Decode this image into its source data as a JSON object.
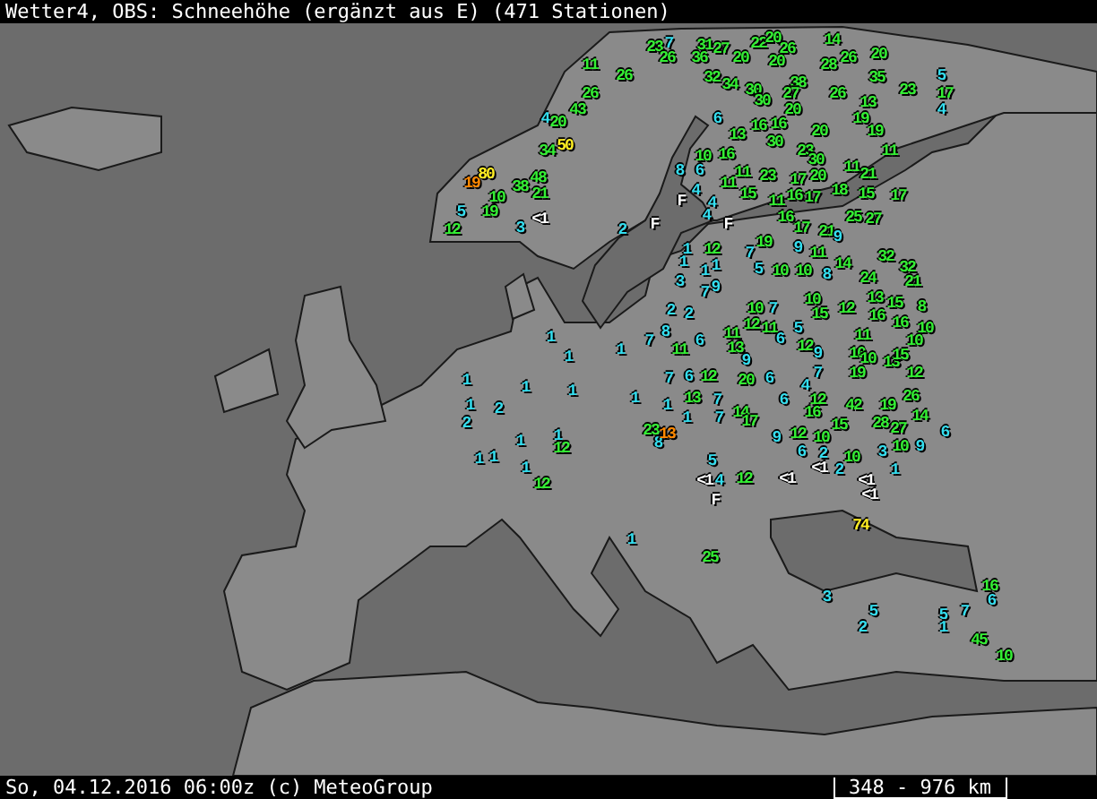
{
  "title_bar": {
    "title": "Wetter4, OBS: Schneehöhe (ergänzt aus E) (471 Stationen)"
  },
  "map": {
    "labels": [
      {
        "text": "23",
        "color": "#33ee33"
      },
      {
        "text": "7",
        "color": "#33ddee"
      },
      {
        "text": "31",
        "color": "#33ee33"
      },
      {
        "text": "27",
        "color": "#33ee33"
      },
      {
        "text": "22",
        "color": "#33ee33"
      },
      {
        "text": "20",
        "color": "#33ee33"
      },
      {
        "text": "26",
        "color": "#33ee33"
      },
      {
        "text": "14",
        "color": "#33ee33"
      },
      {
        "text": "11",
        "color": "#33ee33"
      },
      {
        "text": "26",
        "color": "#33ee33"
      },
      {
        "text": "36",
        "color": "#33ee33"
      },
      {
        "text": "20",
        "color": "#33ee33"
      },
      {
        "text": "20",
        "color": "#33ee33"
      },
      {
        "text": "28",
        "color": "#33ee33"
      },
      {
        "text": "26",
        "color": "#33ee33"
      },
      {
        "text": "20",
        "color": "#33ee33"
      },
      {
        "text": "26",
        "color": "#33ee33"
      },
      {
        "text": "32",
        "color": "#33ee33"
      },
      {
        "text": "34",
        "color": "#33ee33"
      },
      {
        "text": "38",
        "color": "#33ee33"
      },
      {
        "text": "35",
        "color": "#33ee33"
      },
      {
        "text": "5",
        "color": "#33ddee"
      },
      {
        "text": "26",
        "color": "#33ee33"
      },
      {
        "text": "30",
        "color": "#33ee33"
      },
      {
        "text": "27",
        "color": "#33ee33"
      },
      {
        "text": "26",
        "color": "#33ee33"
      },
      {
        "text": "23",
        "color": "#33ee33"
      },
      {
        "text": "17",
        "color": "#33ee33"
      },
      {
        "text": "43",
        "color": "#33ee33"
      },
      {
        "text": "30",
        "color": "#33ee33"
      },
      {
        "text": "20",
        "color": "#33ee33"
      },
      {
        "text": "13",
        "color": "#33ee33"
      },
      {
        "text": "4",
        "color": "#33ddee"
      },
      {
        "text": "4",
        "color": "#33ddee"
      },
      {
        "text": "20",
        "color": "#33ee33"
      },
      {
        "text": "6",
        "color": "#33ddee"
      },
      {
        "text": "16",
        "color": "#33ee33"
      },
      {
        "text": "16",
        "color": "#33ee33"
      },
      {
        "text": "19",
        "color": "#33ee33"
      },
      {
        "text": "13",
        "color": "#33ee33"
      },
      {
        "text": "20",
        "color": "#33ee33"
      },
      {
        "text": "19",
        "color": "#33ee33"
      },
      {
        "text": "34",
        "color": "#33ee33"
      },
      {
        "text": "50",
        "color": "#ffee22"
      },
      {
        "text": "30",
        "color": "#33ee33"
      },
      {
        "text": "23",
        "color": "#33ee33"
      },
      {
        "text": "11",
        "color": "#33ee33"
      },
      {
        "text": "10",
        "color": "#33ee33"
      },
      {
        "text": "16",
        "color": "#33ee33"
      },
      {
        "text": "30",
        "color": "#33ee33"
      },
      {
        "text": "19",
        "color": "#ff8800"
      },
      {
        "text": "80",
        "color": "#ffee22"
      },
      {
        "text": "38",
        "color": "#33ee33"
      },
      {
        "text": "48",
        "color": "#33ee33"
      },
      {
        "text": "8",
        "color": "#33ddee"
      },
      {
        "text": "6",
        "color": "#33ddee"
      },
      {
        "text": "11",
        "color": "#33ee33"
      },
      {
        "text": "11",
        "color": "#33ee33"
      },
      {
        "text": "23",
        "color": "#33ee33"
      },
      {
        "text": "17",
        "color": "#33ee33"
      },
      {
        "text": "20",
        "color": "#33ee33"
      },
      {
        "text": "11",
        "color": "#33ee33"
      },
      {
        "text": "21",
        "color": "#33ee33"
      },
      {
        "text": "10",
        "color": "#33ee33"
      },
      {
        "text": "21",
        "color": "#33ee33"
      },
      {
        "text": "F",
        "color": "#ffffff"
      },
      {
        "text": "4",
        "color": "#33ddee"
      },
      {
        "text": "4",
        "color": "#33ddee"
      },
      {
        "text": "15",
        "color": "#33ee33"
      },
      {
        "text": "11",
        "color": "#33ee33"
      },
      {
        "text": "16",
        "color": "#33ee33"
      },
      {
        "text": "17",
        "color": "#33ee33"
      },
      {
        "text": "18",
        "color": "#33ee33"
      },
      {
        "text": "15",
        "color": "#33ee33"
      },
      {
        "text": "17",
        "color": "#33ee33"
      },
      {
        "text": "12",
        "color": "#33ee33"
      },
      {
        "text": "5",
        "color": "#33ddee"
      },
      {
        "text": "19",
        "color": "#33ee33"
      },
      {
        "text": "3",
        "color": "#33ddee"
      },
      {
        "text": "<1",
        "color": "#ffffff"
      },
      {
        "text": "2",
        "color": "#33ddee"
      },
      {
        "text": "F",
        "color": "#ffffff"
      },
      {
        "text": "4",
        "color": "#33ddee"
      },
      {
        "text": "F",
        "color": "#ffffff"
      },
      {
        "text": "16",
        "color": "#33ee33"
      },
      {
        "text": "25",
        "color": "#33ee33"
      },
      {
        "text": "27",
        "color": "#33ee33"
      },
      {
        "text": "17",
        "color": "#33ee33"
      },
      {
        "text": "21",
        "color": "#33ee33"
      },
      {
        "text": "9",
        "color": "#33ddee"
      },
      {
        "text": "1",
        "color": "#33ddee"
      },
      {
        "text": "12",
        "color": "#33ee33"
      },
      {
        "text": "7",
        "color": "#33ddee"
      },
      {
        "text": "19",
        "color": "#33ee33"
      },
      {
        "text": "9",
        "color": "#33ddee"
      },
      {
        "text": "11",
        "color": "#33ee33"
      },
      {
        "text": "1",
        "color": "#33ddee"
      },
      {
        "text": "1",
        "color": "#33ddee"
      },
      {
        "text": "1",
        "color": "#33ddee"
      },
      {
        "text": "5",
        "color": "#33ddee"
      },
      {
        "text": "10",
        "color": "#33ee33"
      },
      {
        "text": "10",
        "color": "#33ee33"
      },
      {
        "text": "14",
        "color": "#33ee33"
      },
      {
        "text": "32",
        "color": "#33ee33"
      },
      {
        "text": "32",
        "color": "#33ee33"
      },
      {
        "text": "3",
        "color": "#33ddee"
      },
      {
        "text": "8",
        "color": "#33ddee"
      },
      {
        "text": "24",
        "color": "#33ee33"
      },
      {
        "text": "21",
        "color": "#33ee33"
      },
      {
        "text": "7",
        "color": "#33ddee"
      },
      {
        "text": "9",
        "color": "#33ddee"
      },
      {
        "text": "2",
        "color": "#33ddee"
      },
      {
        "text": "2",
        "color": "#33ddee"
      },
      {
        "text": "10",
        "color": "#33ee33"
      },
      {
        "text": "7",
        "color": "#33ddee"
      },
      {
        "text": "10",
        "color": "#33ee33"
      },
      {
        "text": "15",
        "color": "#33ee33"
      },
      {
        "text": "12",
        "color": "#33ee33"
      },
      {
        "text": "13",
        "color": "#33ee33"
      },
      {
        "text": "16",
        "color": "#33ee33"
      },
      {
        "text": "15",
        "color": "#33ee33"
      },
      {
        "text": "8",
        "color": "#33ee33"
      },
      {
        "text": "1",
        "color": "#33ddee"
      },
      {
        "text": "7",
        "color": "#33ddee"
      },
      {
        "text": "8",
        "color": "#33ddee"
      },
      {
        "text": "6",
        "color": "#33ddee"
      },
      {
        "text": "11",
        "color": "#33ee33"
      },
      {
        "text": "12",
        "color": "#33ee33"
      },
      {
        "text": "11",
        "color": "#33ee33"
      },
      {
        "text": "6",
        "color": "#33ddee"
      },
      {
        "text": "5",
        "color": "#33ddee"
      },
      {
        "text": "11",
        "color": "#33ee33"
      },
      {
        "text": "16",
        "color": "#33ee33"
      },
      {
        "text": "10",
        "color": "#33ee33"
      },
      {
        "text": "10",
        "color": "#33ee33"
      },
      {
        "text": "1",
        "color": "#33ddee"
      },
      {
        "text": "1",
        "color": "#33ddee"
      },
      {
        "text": "11",
        "color": "#33ee33"
      },
      {
        "text": "13",
        "color": "#33ee33"
      },
      {
        "text": "9",
        "color": "#33ddee"
      },
      {
        "text": "12",
        "color": "#33ee33"
      },
      {
        "text": "9",
        "color": "#33ddee"
      },
      {
        "text": "10",
        "color": "#33ee33"
      },
      {
        "text": "10",
        "color": "#33ee33"
      },
      {
        "text": "13",
        "color": "#33ee33"
      },
      {
        "text": "15",
        "color": "#33ee33"
      },
      {
        "text": "1",
        "color": "#33ddee"
      },
      {
        "text": "1",
        "color": "#33ddee"
      },
      {
        "text": "1",
        "color": "#33ddee"
      },
      {
        "text": "7",
        "color": "#33ddee"
      },
      {
        "text": "6",
        "color": "#33ddee"
      },
      {
        "text": "12",
        "color": "#33ee33"
      },
      {
        "text": "20",
        "color": "#33ee33"
      },
      {
        "text": "6",
        "color": "#33ddee"
      },
      {
        "text": "4",
        "color": "#33ddee"
      },
      {
        "text": "7",
        "color": "#33ddee"
      },
      {
        "text": "19",
        "color": "#33ee33"
      },
      {
        "text": "12",
        "color": "#33ee33"
      },
      {
        "text": "1",
        "color": "#33ddee"
      },
      {
        "text": "2",
        "color": "#33ddee"
      },
      {
        "text": "1",
        "color": "#33ddee"
      },
      {
        "text": "1",
        "color": "#33ddee"
      },
      {
        "text": "13",
        "color": "#33ee33"
      },
      {
        "text": "7",
        "color": "#33ddee"
      },
      {
        "text": "6",
        "color": "#33ddee"
      },
      {
        "text": "12",
        "color": "#33ee33"
      },
      {
        "text": "42",
        "color": "#33ee33"
      },
      {
        "text": "19",
        "color": "#33ee33"
      },
      {
        "text": "26",
        "color": "#33ee33"
      },
      {
        "text": "2",
        "color": "#33ddee"
      },
      {
        "text": "1",
        "color": "#33ddee"
      },
      {
        "text": "7",
        "color": "#33ddee"
      },
      {
        "text": "14",
        "color": "#33ee33"
      },
      {
        "text": "17",
        "color": "#33ee33"
      },
      {
        "text": "16",
        "color": "#33ee33"
      },
      {
        "text": "15",
        "color": "#33ee33"
      },
      {
        "text": "28",
        "color": "#33ee33"
      },
      {
        "text": "14",
        "color": "#33ee33"
      },
      {
        "text": "1",
        "color": "#33ddee"
      },
      {
        "text": "1",
        "color": "#33ddee"
      },
      {
        "text": "12",
        "color": "#33ee33"
      },
      {
        "text": "23",
        "color": "#33ee33"
      },
      {
        "text": "8",
        "color": "#33ddee"
      },
      {
        "text": "13",
        "color": "#ff8800"
      },
      {
        "text": "9",
        "color": "#33ddee"
      },
      {
        "text": "12",
        "color": "#33ee33"
      },
      {
        "text": "10",
        "color": "#33ee33"
      },
      {
        "text": "27",
        "color": "#33ee33"
      },
      {
        "text": "6",
        "color": "#33ddee"
      },
      {
        "text": "1",
        "color": "#33ddee"
      },
      {
        "text": "1",
        "color": "#33ddee"
      },
      {
        "text": "5",
        "color": "#33ddee"
      },
      {
        "text": "6",
        "color": "#33ddee"
      },
      {
        "text": "2",
        "color": "#33ddee"
      },
      {
        "text": "10",
        "color": "#33ee33"
      },
      {
        "text": "3",
        "color": "#33ddee"
      },
      {
        "text": "10",
        "color": "#33ee33"
      },
      {
        "text": "9",
        "color": "#33ddee"
      },
      {
        "text": "1",
        "color": "#33ddee"
      },
      {
        "text": "12",
        "color": "#33ee33"
      },
      {
        "text": "<1",
        "color": "#ffffff"
      },
      {
        "text": "4",
        "color": "#33ddee"
      },
      {
        "text": "12",
        "color": "#33ee33"
      },
      {
        "text": "<1",
        "color": "#ffffff"
      },
      {
        "text": "<1",
        "color": "#ffffff"
      },
      {
        "text": "2",
        "color": "#33ddee"
      },
      {
        "text": "<1",
        "color": "#ffffff"
      },
      {
        "text": "1",
        "color": "#33ddee"
      },
      {
        "text": "F",
        "color": "#ffffff"
      },
      {
        "text": "<1",
        "color": "#ffffff"
      },
      {
        "text": "74",
        "color": "#ffee22"
      },
      {
        "text": "1",
        "color": "#33ddee"
      },
      {
        "text": "25",
        "color": "#33ee33"
      },
      {
        "text": "16",
        "color": "#33ee33"
      },
      {
        "text": "3",
        "color": "#33ddee"
      },
      {
        "text": "6",
        "color": "#33ddee"
      },
      {
        "text": "5",
        "color": "#33ddee"
      },
      {
        "text": "5",
        "color": "#33ddee"
      },
      {
        "text": "7",
        "color": "#33ddee"
      },
      {
        "text": "2",
        "color": "#33ddee"
      },
      {
        "text": "1",
        "color": "#33ddee"
      },
      {
        "text": "45",
        "color": "#33ee33"
      },
      {
        "text": "10",
        "color": "#33ee33"
      }
    ]
  },
  "status_bar": {
    "timestamp": "So, 04.12.2016 06:00z (c) MeteoGroup",
    "scale": "348 - 976 km"
  }
}
